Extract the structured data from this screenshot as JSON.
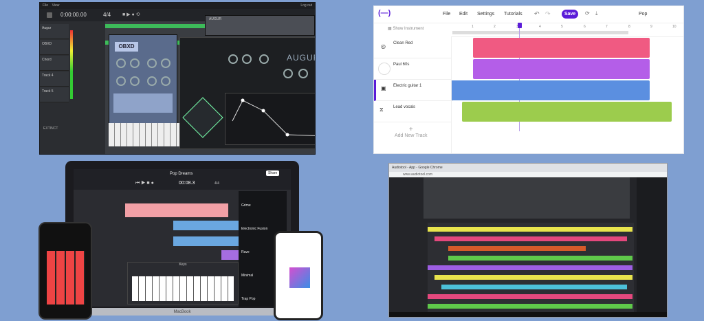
{
  "daw_top_left": {
    "menu": [
      "File",
      "View"
    ],
    "menu_right": "Log out",
    "time": "0:00:00.00",
    "signature": "4/4",
    "tracks": [
      "Augur",
      "OBXD",
      "Chord",
      "Track 4",
      "Track 5"
    ],
    "synths": {
      "obxd": "OBXD",
      "augur": "AUGUR",
      "augur_small": "AUGUR"
    },
    "bottom_label": "EXTINCT"
  },
  "web_daw_top_right": {
    "menu": [
      "File",
      "Edit",
      "Settings",
      "Tutorials"
    ],
    "save_label": "Save",
    "project_name": "Pop",
    "show_instrument": "Show Instrument",
    "ruler": [
      "1",
      "2",
      "3",
      "4",
      "5",
      "6",
      "7",
      "8",
      "9",
      "10"
    ],
    "tracks": [
      {
        "name": "Clean Red",
        "color": "#f05a82"
      },
      {
        "name": "Paul 60s",
        "color": "#b45ee8"
      },
      {
        "name": "Electric guitar 1",
        "color": "#5b8fe0"
      },
      {
        "name": "Lead vocals",
        "color": "#9ccc4d"
      }
    ],
    "add_track": "Add New Track",
    "accent": "#5b1cd8"
  },
  "laptop_bottom_left": {
    "project_title": "Pop Dreams",
    "share_label": "Share",
    "time": "00:08.3",
    "tempo": "4/4",
    "keyboard_title": "Keys",
    "brand": "MacBook",
    "loop_items": [
      "Grime",
      "Electronic Fusion",
      "Rave",
      "Minimal",
      "Trap Pop"
    ]
  },
  "browser_bottom_right": {
    "tab_title": "Audiotool - App - Google Chrome",
    "url": "www.audiotool.com"
  }
}
